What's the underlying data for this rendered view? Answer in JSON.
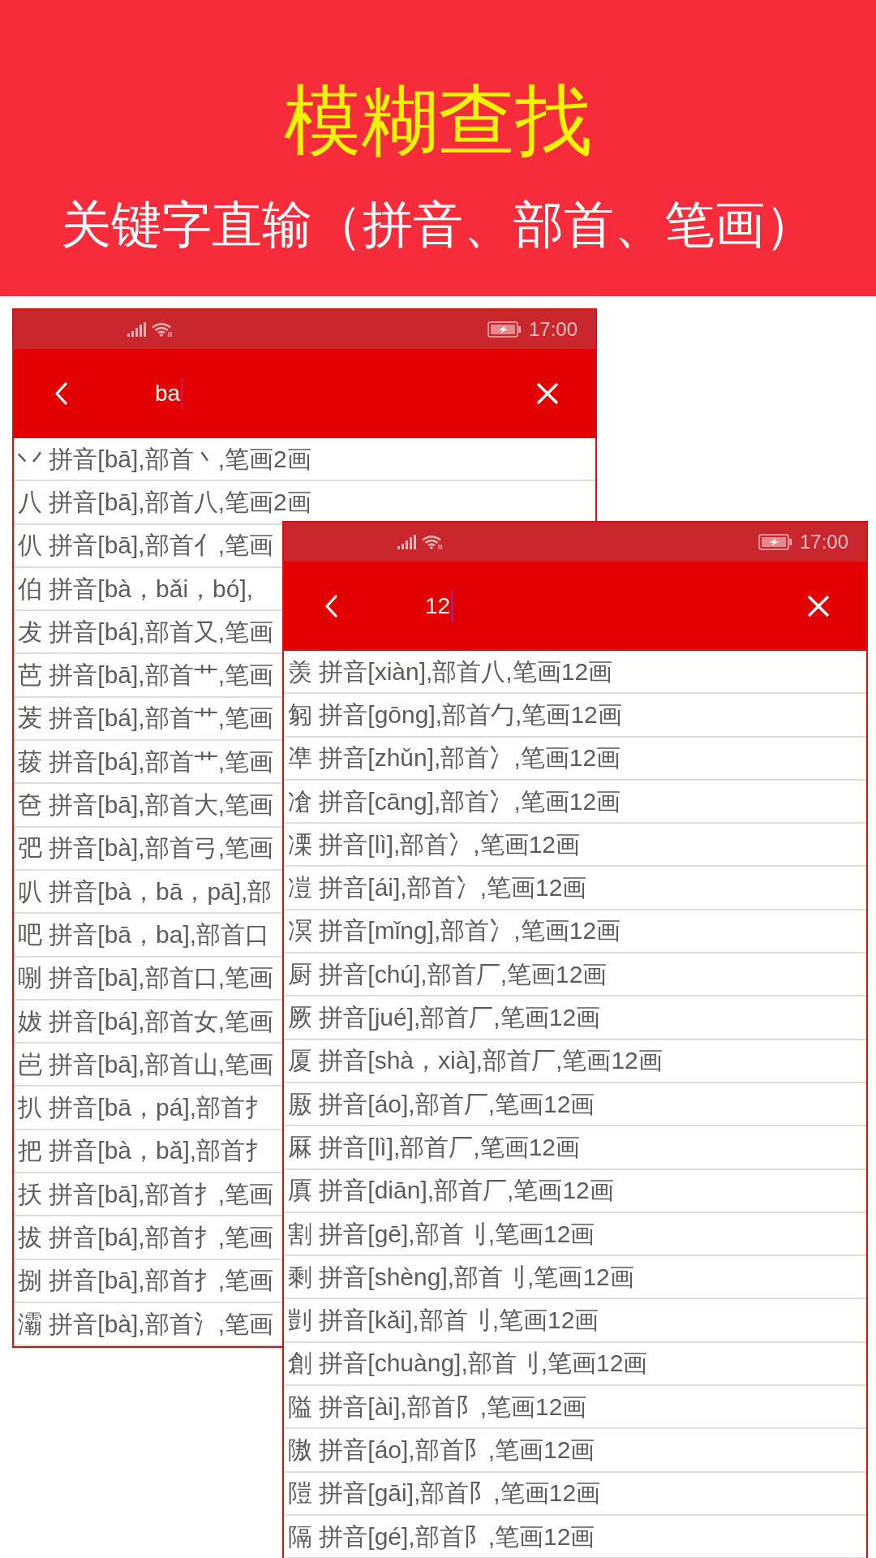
{
  "banner": {
    "title": "模糊查找",
    "subtitle": "关键字直输（拼音、部首、笔画）"
  },
  "screens": [
    {
      "status_bar": {
        "time": "17:00"
      },
      "search": {
        "value": "ba",
        "focused": true
      },
      "results": [
        "丷 拼音[bā],部首丶,笔画2画",
        "八 拼音[bā],部首八,笔画2画",
        "仈 拼音[bā],部首亻,笔画",
        "伯 拼音[bà，bǎi，bó],",
        "犮 拼音[bá],部首又,笔画",
        "芭 拼音[bā],部首艹,笔画",
        "茇 拼音[bá],部首艹,笔画",
        "菝 拼音[bá],部首艹,笔画",
        "夿 拼音[bā],部首大,笔画",
        "弝 拼音[bà],部首弓,笔画",
        "叭 拼音[bà，bā，pā],部",
        "吧 拼音[bā，ba],部首口",
        "哵 拼音[bā],部首口,笔画",
        "妭 拼音[bá],部首女,笔画",
        "岜 拼音[bā],部首山,笔画",
        "扒 拼音[bā，pá],部首扌",
        "把 拼音[bà，bǎ],部首扌",
        "扷 拼音[bā],部首扌,笔画",
        "拔 拼音[bá],部首扌,笔画",
        "捌 拼音[bā],部首扌,笔画",
        "灞 拼音[bà],部首氵,笔画"
      ]
    },
    {
      "status_bar": {
        "time": "17:00"
      },
      "search": {
        "value": "12",
        "focused": true
      },
      "results": [
        "羡 拼音[xiàn],部首八,笔画12画",
        "匑 拼音[gōng],部首勹,笔画12画",
        "凖 拼音[zhǔn],部首冫,笔画12画",
        "凔 拼音[cāng],部首冫,笔画12画",
        "凓 拼音[lì],部首冫,笔画12画",
        "凒 拼音[ái],部首冫,笔画12画",
        "凕 拼音[mǐng],部首冫,笔画12画",
        "厨 拼音[chú],部首厂,笔画12画",
        "厥 拼音[jué],部首厂,笔画12画",
        "厦 拼音[shà，xià],部首厂,笔画12画",
        "厫 拼音[áo],部首厂,笔画12画",
        "厤 拼音[lì],部首厂,笔画12画",
        "厧 拼音[diān],部首厂,笔画12画",
        "割 拼音[gē],部首刂,笔画12画",
        "剩 拼音[shèng],部首刂,笔画12画",
        "剴 拼音[kǎi],部首刂,笔画12画",
        "創 拼音[chuàng],部首刂,笔画12画",
        "隘 拼音[ài],部首阝,笔画12画",
        "隞 拼音[áo],部首阝,笔画12画",
        "隑 拼音[gāi],部首阝,笔画12画",
        "隔 拼音[gé],部首阝,笔画12画"
      ]
    }
  ]
}
